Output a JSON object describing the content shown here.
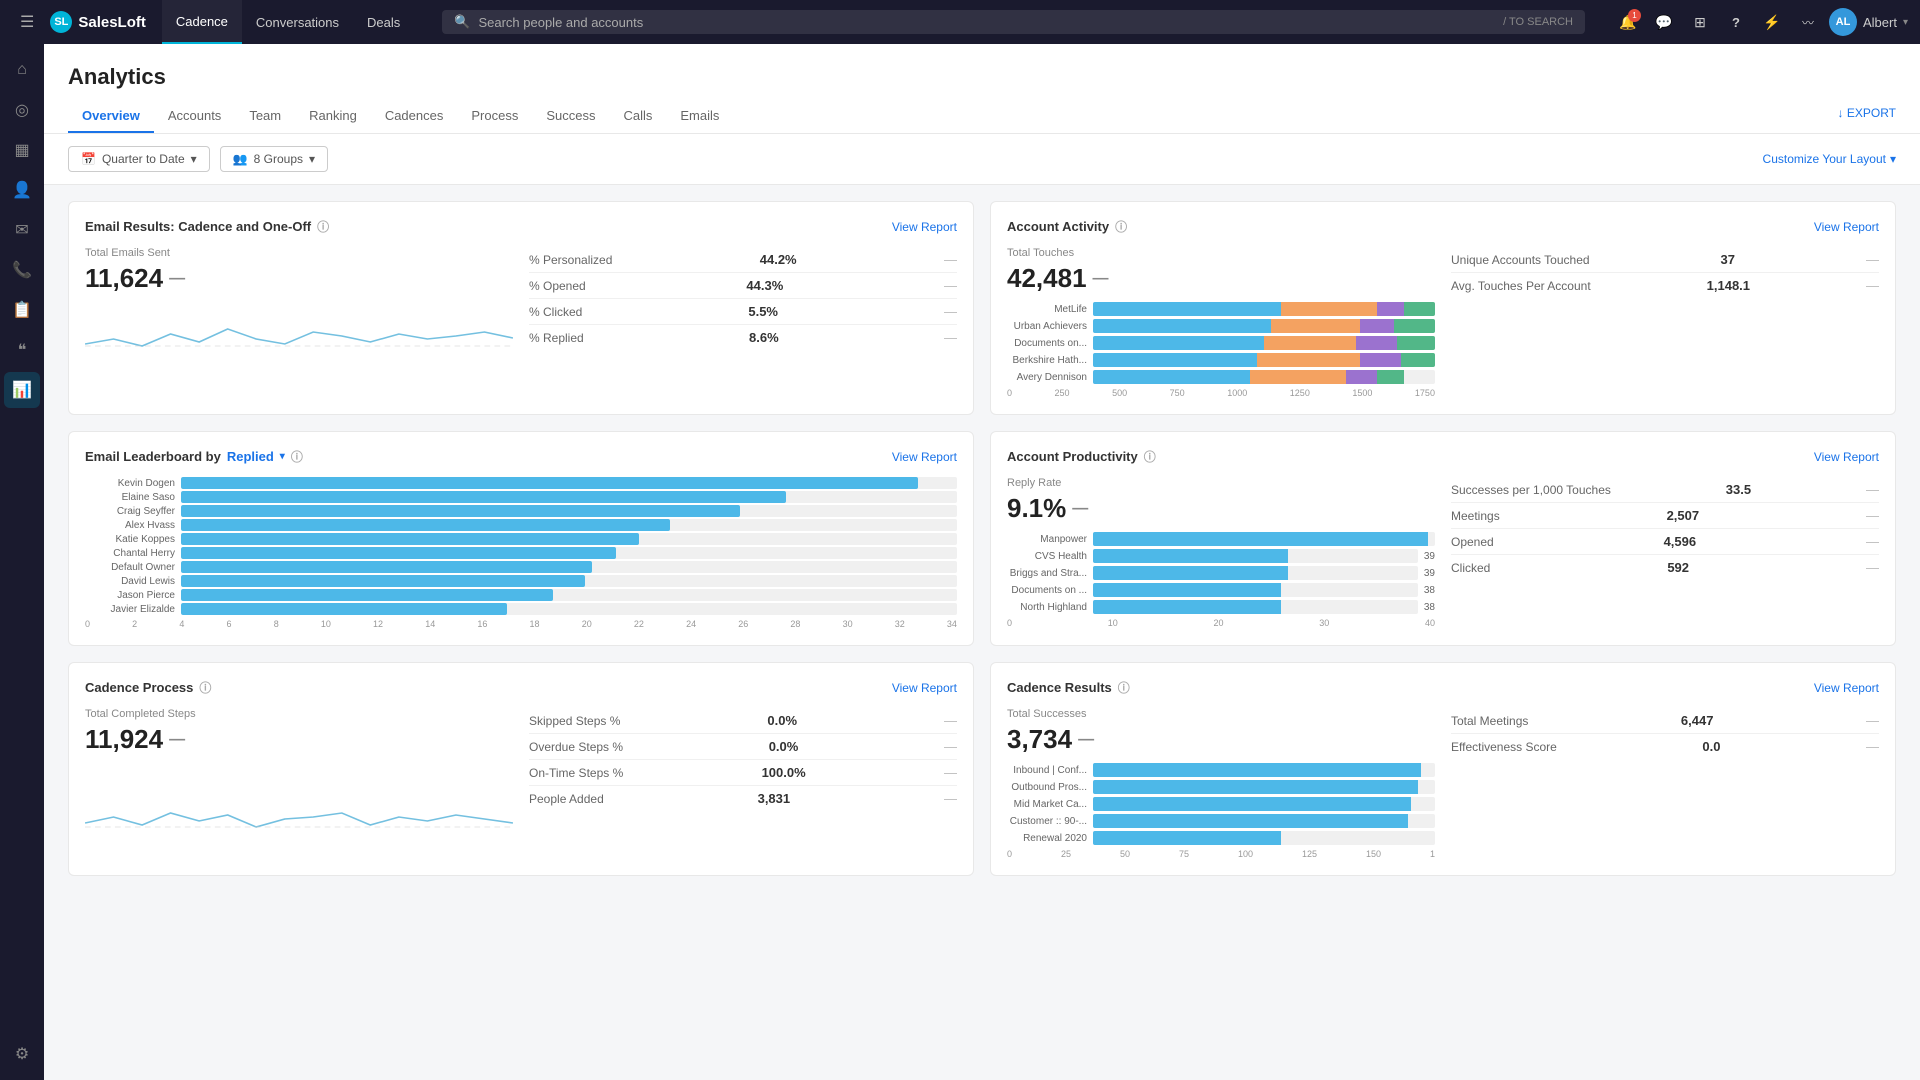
{
  "topNav": {
    "hamburger": "☰",
    "logo": "SalesLoft",
    "logoInitial": "SL",
    "navItems": [
      {
        "label": "Cadence",
        "active": true
      },
      {
        "label": "Conversations",
        "active": false
      },
      {
        "label": "Deals",
        "active": false
      }
    ],
    "search": {
      "placeholder": "Search people and accounts",
      "hint": "/ TO SEARCH"
    },
    "icons": {
      "bell": "🔔",
      "chat": "💬",
      "grid": "⊞",
      "question": "?",
      "lightning": "⚡",
      "signal": "📶"
    },
    "bellBadge": "1",
    "userName": "Albert",
    "userInitials": "AL"
  },
  "sidebar": {
    "items": [
      {
        "icon": "⌂",
        "name": "home",
        "active": false
      },
      {
        "icon": "◎",
        "name": "target",
        "active": false
      },
      {
        "icon": "▦",
        "name": "grid2",
        "active": false
      },
      {
        "icon": "👤",
        "name": "person",
        "active": false
      },
      {
        "icon": "✉",
        "name": "email",
        "active": false
      },
      {
        "icon": "📞",
        "name": "phone",
        "active": false
      },
      {
        "icon": "📋",
        "name": "clipboard",
        "active": false
      },
      {
        "icon": "❝",
        "name": "quote",
        "active": false
      },
      {
        "icon": "📊",
        "name": "chart",
        "active": true
      },
      {
        "icon": "⚙",
        "name": "settings",
        "active": false
      }
    ]
  },
  "page": {
    "title": "Analytics"
  },
  "subNav": {
    "items": [
      {
        "label": "Overview",
        "active": true
      },
      {
        "label": "Accounts",
        "active": false
      },
      {
        "label": "Team",
        "active": false
      },
      {
        "label": "Ranking",
        "active": false
      },
      {
        "label": "Cadences",
        "active": false
      },
      {
        "label": "Process",
        "active": false
      },
      {
        "label": "Success",
        "active": false
      },
      {
        "label": "Calls",
        "active": false
      },
      {
        "label": "Emails",
        "active": false
      }
    ],
    "exportLabel": "↓ EXPORT"
  },
  "toolbar": {
    "filter1Label": "Quarter to Date",
    "filter2Label": "8 Groups",
    "customizeLabel": "Customize Your Layout",
    "customizeChevron": "▾"
  },
  "emailResults": {
    "title": "Email Results: Cadence and One-Off",
    "viewReport": "View Report",
    "totalEmailsLabel": "Total Emails Sent",
    "totalEmailsValue": "11,624",
    "dash": "—",
    "stats": [
      {
        "label": "% Personalized",
        "value": "44.2%"
      },
      {
        "label": "% Opened",
        "value": "44.3%"
      },
      {
        "label": "% Clicked",
        "value": "5.5%"
      },
      {
        "label": "% Replied",
        "value": "8.6%"
      }
    ]
  },
  "accountActivity": {
    "title": "Account Activity",
    "viewReport": "View Report",
    "totalTouchesLabel": "Total Touches",
    "totalTouchesValue": "42,481",
    "dash": "—",
    "stats": [
      {
        "label": "Unique Accounts Touched",
        "value": "37"
      },
      {
        "label": "Avg. Touches Per Account",
        "value": "1,148.1"
      }
    ],
    "bars": [
      {
        "label": "MetLife",
        "blue": 55,
        "orange": 28,
        "purple": 8,
        "green": 9
      },
      {
        "label": "Urban Achievers",
        "blue": 52,
        "orange": 26,
        "purple": 10,
        "green": 12
      },
      {
        "label": "Documents on...",
        "blue": 50,
        "orange": 27,
        "purple": 12,
        "green": 11
      },
      {
        "label": "Berkshire Hath...",
        "blue": 48,
        "orange": 30,
        "purple": 12,
        "green": 10
      },
      {
        "label": "Avery Dennison",
        "blue": 46,
        "orange": 28,
        "purple": 9,
        "green": 8
      }
    ],
    "axisLabels": [
      "0",
      "250",
      "500",
      "750",
      "1000",
      "1250",
      "1500",
      "1750"
    ]
  },
  "emailLeaderboard": {
    "title": "Email Leaderboard by",
    "sortBy": "Replied",
    "viewReport": "View Report",
    "people": [
      {
        "name": "Kevin Dogen",
        "pct": 95
      },
      {
        "name": "Elaine Saso",
        "pct": 78
      },
      {
        "name": "Craig Seyffer",
        "pct": 72
      },
      {
        "name": "Alex Hvass",
        "pct": 63
      },
      {
        "name": "Katie Koppes",
        "pct": 59
      },
      {
        "name": "Chantal Herry",
        "pct": 56
      },
      {
        "name": "Default Owner",
        "pct": 53
      },
      {
        "name": "David Lewis",
        "pct": 52
      },
      {
        "name": "Jason Pierce",
        "pct": 48
      },
      {
        "name": "Javier Elizalde",
        "pct": 42
      }
    ],
    "axisLabels": [
      "0",
      "2",
      "4",
      "6",
      "8",
      "10",
      "12",
      "14",
      "16",
      "18",
      "20",
      "22",
      "24",
      "26",
      "28",
      "30",
      "32",
      "34"
    ]
  },
  "accountProductivity": {
    "title": "Account Productivity",
    "viewReport": "View Report",
    "replyRateLabel": "Reply Rate",
    "replyRateValue": "9.1%",
    "dash": "—",
    "stats": [
      {
        "label": "Successes per 1,000 Touches",
        "value": "33.5"
      },
      {
        "label": "Meetings",
        "value": "2,507"
      },
      {
        "label": "Opened",
        "value": "4,596"
      },
      {
        "label": "Clicked",
        "value": "592"
      }
    ],
    "bars": [
      {
        "label": "Manpower",
        "pct": 98,
        "val": ""
      },
      {
        "label": "CVS Health",
        "pct": 60,
        "val": "39"
      },
      {
        "label": "Briggs and Stra...",
        "pct": 60,
        "val": "39"
      },
      {
        "label": "Documents on ...",
        "pct": 58,
        "val": "38"
      },
      {
        "label": "North Highland",
        "pct": 58,
        "val": "38"
      }
    ],
    "axisLabels": [
      "0",
      "10",
      "20",
      "30",
      "40"
    ]
  },
  "cadenceProcess": {
    "title": "Cadence Process",
    "viewReport": "View Report",
    "totalStepsLabel": "Total Completed Steps",
    "totalStepsValue": "11,924",
    "dash": "—",
    "stats": [
      {
        "label": "Skipped Steps %",
        "value": "0.0%"
      },
      {
        "label": "Overdue Steps %",
        "value": "0.0%"
      },
      {
        "label": "On-Time Steps %",
        "value": "100.0%"
      },
      {
        "label": "People Added",
        "value": "3,831"
      }
    ]
  },
  "cadenceResults": {
    "title": "Cadence Results",
    "viewReport": "View Report",
    "totalSuccessesLabel": "Total Successes",
    "totalSuccessesValue": "3,734",
    "dash": "—",
    "stats": [
      {
        "label": "Total Meetings",
        "value": "6,447"
      },
      {
        "label": "Effectiveness Score",
        "value": "0.0"
      }
    ],
    "bars": [
      {
        "label": "Inbound | Conf...",
        "pct": 96
      },
      {
        "label": "Outbound Pros...",
        "pct": 95
      },
      {
        "label": "Mid Market Ca...",
        "pct": 93
      },
      {
        "label": "Customer :: 90-...",
        "pct": 92
      },
      {
        "label": "Renewal 2020",
        "pct": 55
      }
    ],
    "axisLabels": [
      "0",
      "25",
      "50",
      "75",
      "100",
      "125",
      "150",
      "1"
    ]
  }
}
